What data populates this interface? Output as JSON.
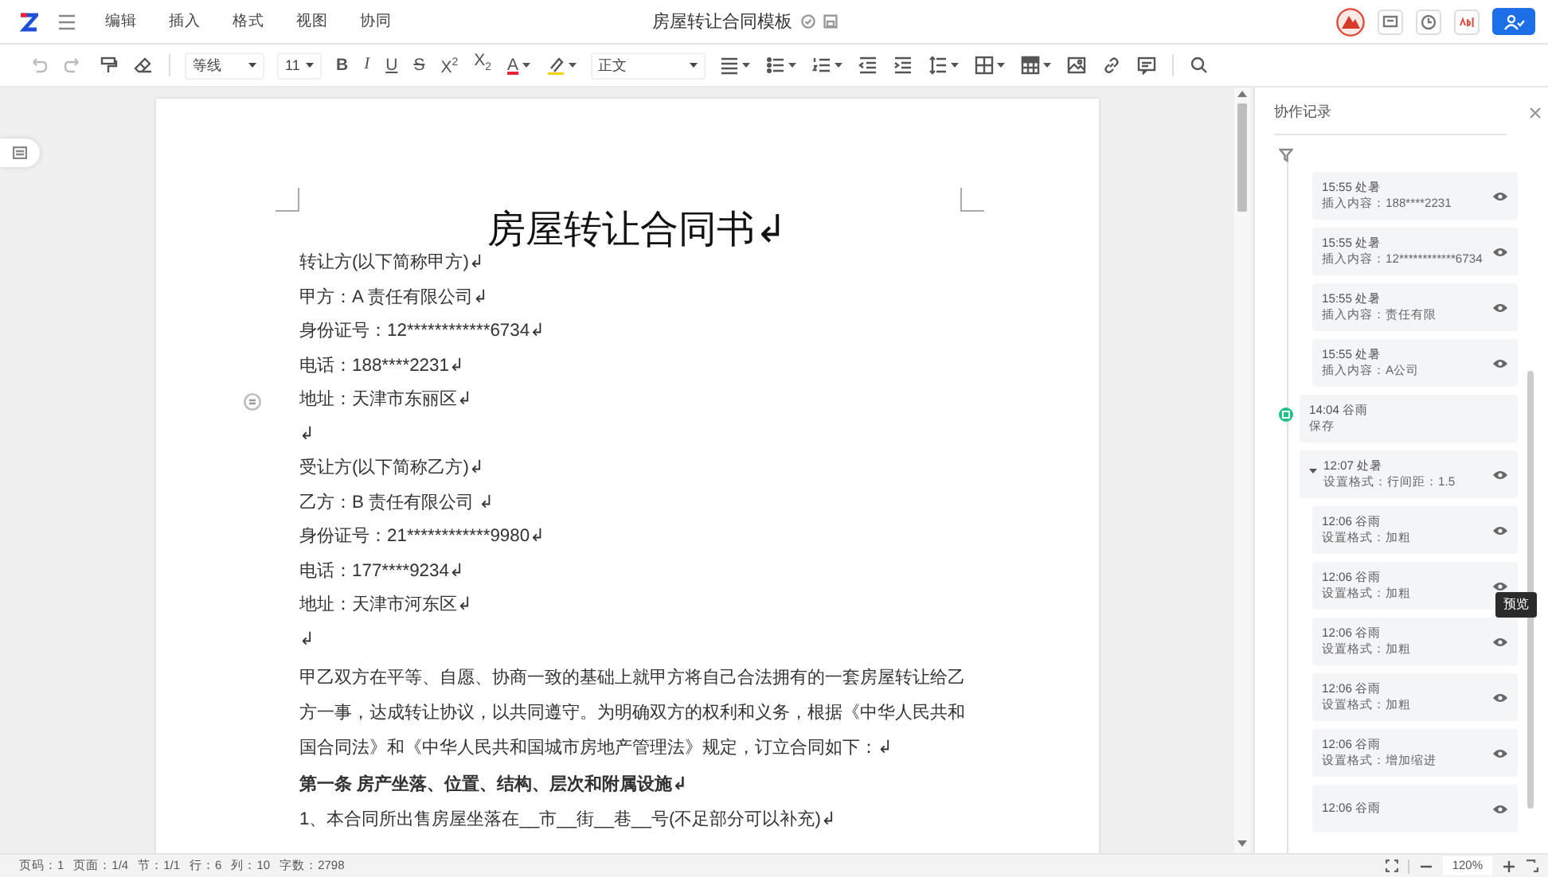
{
  "menu": {
    "items": [
      "编辑",
      "插入",
      "格式",
      "视图",
      "协同"
    ]
  },
  "document_title": "房屋转让合同模板",
  "toolbar": [
    {
      "kind": "undo",
      "disabled": true,
      "dropdown": false
    },
    {
      "kind": "redo",
      "disabled": true,
      "dropdown": false
    },
    {
      "kind": "painter",
      "disabled": false,
      "dropdown": false
    },
    {
      "kind": "eraser",
      "disabled": false,
      "dropdown": false
    },
    {
      "kind": "separator"
    },
    {
      "kind": "font-select",
      "value": "等线"
    },
    {
      "kind": "size-select",
      "value": "11"
    },
    {
      "kind": "bold",
      "label": "B",
      "disabled": false,
      "dropdown": false
    },
    {
      "kind": "italic",
      "label": "I",
      "disabled": false,
      "dropdown": false
    },
    {
      "kind": "underline",
      "label": "U",
      "disabled": false,
      "dropdown": false
    },
    {
      "kind": "strike",
      "label": "S",
      "disabled": false,
      "dropdown": false
    },
    {
      "kind": "script",
      "label": "X$^{2}$",
      "disabled": false,
      "dropdown": false
    },
    {
      "kind": "script",
      "label": "X$_{2}$",
      "disabled": false,
      "dropdown": false
    },
    {
      "kind": "font-color",
      "label": "A",
      "disabled": false,
      "dropdown": true
    },
    {
      "kind": "highlight",
      "disabled": false,
      "dropdown": true
    },
    {
      "kind": "style-select",
      "value": "正文"
    },
    {
      "kind": "align",
      "disabled": false,
      "dropdown": true
    },
    {
      "kind": "bullets",
      "disabled": false,
      "dropdown": true
    },
    {
      "kind": "numbering",
      "disabled": false,
      "dropdown": true
    },
    {
      "kind": "outdent",
      "disabled": false,
      "dropdown": false
    },
    {
      "kind": "indent",
      "disabled": false,
      "dropdown": false
    },
    {
      "kind": "spacing",
      "disabled": false,
      "dropdown": true
    },
    {
      "kind": "border",
      "disabled": false,
      "dropdown": true
    },
    {
      "kind": "table",
      "disabled": false,
      "dropdown": true
    },
    {
      "kind": "image",
      "disabled": false,
      "dropdown": false
    },
    {
      "kind": "link",
      "disabled": false,
      "dropdown": false
    },
    {
      "kind": "comment",
      "disabled": false,
      "dropdown": false
    },
    {
      "kind": "separator"
    },
    {
      "kind": "search",
      "disabled": false,
      "dropdown": false
    }
  ],
  "document": {
    "paragraphs": [
      {
        "kind": "title",
        "text": "房屋转让合同书↲",
        "handle": false
      },
      {
        "kind": "line",
        "text": "转让方(以下简称甲方)↲",
        "handle": false
      },
      {
        "kind": "line",
        "text": "甲方：A 责任有限公司↲",
        "handle": false
      },
      {
        "kind": "line",
        "text": "身份证号：12************6734↲",
        "handle": false
      },
      {
        "kind": "line",
        "text": "电话：188****2231↲",
        "handle": false
      },
      {
        "kind": "line",
        "text": "地址：天津市东丽区↲",
        "handle": true
      },
      {
        "kind": "line",
        "text": "↲",
        "handle": false
      },
      {
        "kind": "line",
        "text": "受让方(以下简称乙方)↲",
        "handle": false
      },
      {
        "kind": "line",
        "text": "乙方：B 责任有限公司 ↲",
        "handle": false
      },
      {
        "kind": "line",
        "text": "身份证号：21************9980↲",
        "handle": false
      },
      {
        "kind": "line",
        "text": "电话：177****9234↲",
        "handle": false
      },
      {
        "kind": "line",
        "text": "地址：天津市河东区↲",
        "handle": false
      },
      {
        "kind": "line",
        "text": "↲",
        "handle": false
      },
      {
        "kind": "line",
        "text": "甲乙双方在平等、自愿、协商一致的基础上就甲方将自己合法拥有的一套房屋转让给乙方一事，达成转让协议，以共同遵守。为明确双方的权利和义务，根据《中华人民共和国合同法》和《中华人民共和国城市房地产管理法》规定，订立合同如下：↲",
        "handle": false
      },
      {
        "kind": "heading",
        "text": "第一条  房产坐落、位置、结构、层次和附属设施↲",
        "handle": false
      },
      {
        "kind": "line",
        "text": "1、本合同所出售房屋坐落在__市__街__巷__号(不足部分可以补充)↲",
        "handle": false
      }
    ]
  },
  "history": {
    "title": "协作记录",
    "entries": [
      {
        "kind": "group",
        "children": [
          {
            "time": "15:55",
            "user": "处暑",
            "action": "插入内容：188****2231"
          },
          {
            "time": "15:55",
            "user": "处暑",
            "action": "插入内容：12************6734"
          },
          {
            "time": "15:55",
            "user": "处暑",
            "action": "插入内容：责任有限"
          },
          {
            "time": "15:55",
            "user": "处暑",
            "action": "插入内容：A公司"
          }
        ]
      },
      {
        "kind": "save",
        "time": "14:04",
        "user": "谷雨",
        "action": "保存"
      },
      {
        "kind": "group",
        "time": "12:07",
        "user": "处暑",
        "action": "设置格式：行间距：1.5",
        "expanded": true,
        "children": [
          {
            "time": "12:06",
            "user": "谷雨",
            "action": "设置格式：加粗"
          },
          {
            "time": "12:06",
            "user": "谷雨",
            "action": "设置格式：加粗",
            "tooltip": "预览"
          },
          {
            "time": "12:06",
            "user": "谷雨",
            "action": "设置格式：加粗"
          },
          {
            "time": "12:06",
            "user": "谷雨",
            "action": "设置格式：加粗"
          },
          {
            "time": "12:06",
            "user": "谷雨",
            "action": "设置格式：增加缩进"
          },
          {
            "time": "12:06",
            "user": "谷雨"
          }
        ]
      }
    ]
  },
  "status_bar": {
    "items": [
      "页码：1",
      "页面：1/4",
      "节：1/1",
      "行：6",
      "列：10",
      "字数：2798"
    ],
    "zoom": "120%"
  }
}
